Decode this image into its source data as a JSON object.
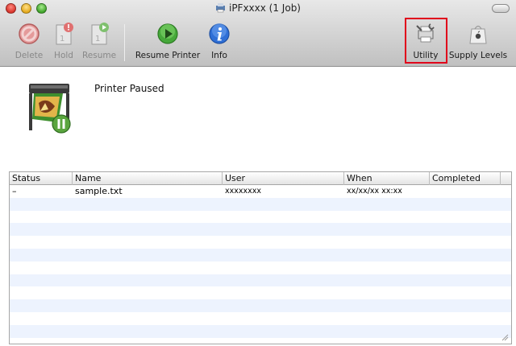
{
  "window": {
    "title": "iPFxxxx (1 Job)"
  },
  "toolbar": {
    "buttons": [
      {
        "label": "Delete",
        "enabled": false,
        "icon": "delete-icon"
      },
      {
        "label": "Hold",
        "enabled": false,
        "icon": "hold-icon"
      },
      {
        "label": "Resume",
        "enabled": false,
        "icon": "resume-job-icon"
      },
      {
        "label": "Resume Printer",
        "enabled": true,
        "icon": "resume-printer-icon"
      },
      {
        "label": "Info",
        "enabled": true,
        "icon": "info-icon"
      },
      {
        "label": "Utility",
        "enabled": true,
        "icon": "utility-icon"
      },
      {
        "label": "Supply Levels",
        "enabled": true,
        "icon": "supply-levels-icon"
      }
    ],
    "highlighted": "Utility"
  },
  "printer": {
    "status": "Printer Paused"
  },
  "jobs_table": {
    "columns": [
      "Status",
      "Name",
      "User",
      "When",
      "Completed"
    ],
    "rows": [
      {
        "status": "–",
        "name": "sample.txt",
        "user": "xxxxxxxx",
        "when": "xx/xx/xx xx:xx",
        "completed": ""
      }
    ]
  },
  "colors": {
    "highlight_border": "#e0001b",
    "alt_row": "#edf3fe"
  }
}
